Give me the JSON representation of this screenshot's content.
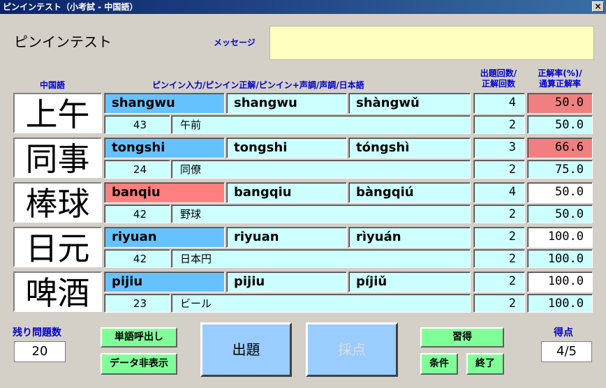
{
  "window": {
    "title": "ピンインテスト（小考試 - 中国語）",
    "close": "×"
  },
  "app_title": "ピンインテスト",
  "message_label": "メッセージ",
  "message_text": "",
  "headers": {
    "chinese": "中国語",
    "pinyin": "ピンイン入力/ピンイン正解/ピンイン+声調/声調/日本語",
    "counts": [
      "出題回数/",
      "正解回数"
    ],
    "rates": [
      "正解率(%)/",
      "通算正解率"
    ]
  },
  "rows": [
    {
      "word": "上午",
      "input": "shangwu",
      "answer": "shangwu",
      "tone": "shàngwǔ",
      "index": "43",
      "japanese": "午前",
      "asked": "4",
      "correct": "2",
      "rate": "50.0",
      "total_rate": "50.0",
      "input_status": "blue",
      "rate_status": "red"
    },
    {
      "word": "同事",
      "input": "tongshi",
      "answer": "tongshi",
      "tone": "tóngshì",
      "index": "24",
      "japanese": "同僚",
      "asked": "3",
      "correct": "2",
      "rate": "66.6",
      "total_rate": "75.0",
      "input_status": "blue",
      "rate_status": "red"
    },
    {
      "word": "棒球",
      "input": "banqiu",
      "answer": "bangqiu",
      "tone": "bàngqiú",
      "index": "42",
      "japanese": "野球",
      "asked": "4",
      "correct": "2",
      "rate": "50.0",
      "total_rate": "50.0",
      "input_status": "red",
      "rate_status": "white"
    },
    {
      "word": "日元",
      "input": "riyuan",
      "answer": "riyuan",
      "tone": "rìyuán",
      "index": "42",
      "japanese": "日本円",
      "asked": "2",
      "correct": "2",
      "rate": "100.0",
      "total_rate": "100.0",
      "input_status": "blue",
      "rate_status": "white"
    },
    {
      "word": "啤酒",
      "input": "pijiu",
      "answer": "pijiu",
      "tone": "píjiǔ",
      "index": "23",
      "japanese": "ビール",
      "asked": "2",
      "correct": "2",
      "rate": "100.0",
      "total_rate": "100.0",
      "input_status": "blue",
      "rate_status": "white"
    }
  ],
  "remaining_label": "残り問題数",
  "remaining_value": "20",
  "buttons": {
    "recall": "単語呼出し",
    "hide_data": "データ非表示",
    "ask": "出題",
    "grade": "採点",
    "learn": "習得",
    "conditions": "条件",
    "quit": "終了"
  },
  "score_label": "得点",
  "score_value": "4/5",
  "colors": {
    "input_ok": "#66c2ff",
    "input_wrong": "#ff7f7f",
    "rate_low": "#f08080",
    "cell": "#ccffff",
    "button": "#80ff99"
  }
}
